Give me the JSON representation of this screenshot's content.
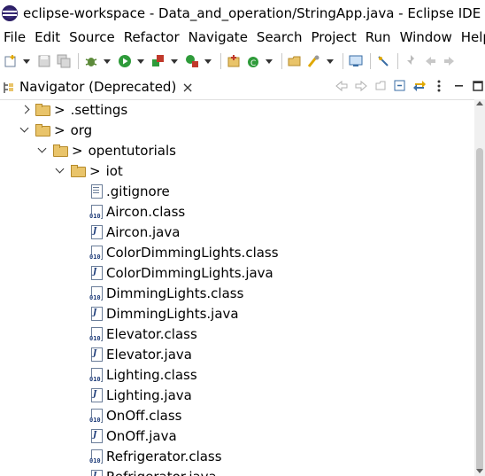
{
  "window": {
    "title": "eclipse-workspace - Data_and_operation/StringApp.java - Eclipse IDE"
  },
  "menubar": {
    "items": [
      {
        "label": "File"
      },
      {
        "label": "Edit"
      },
      {
        "label": "Source"
      },
      {
        "label": "Refactor"
      },
      {
        "label": "Navigate"
      },
      {
        "label": "Search"
      },
      {
        "label": "Project"
      },
      {
        "label": "Run"
      },
      {
        "label": "Window"
      },
      {
        "label": "Help"
      }
    ]
  },
  "toolbar": {
    "icons": [
      "new-icon",
      "save-icon",
      "save-all-icon",
      "debug-icon",
      "run-icon",
      "coverage-icon",
      "external-tools-icon",
      "new-java-project-icon",
      "new-class-icon",
      "open-type-icon",
      "search-icon",
      "console-icon",
      "toggle-mark-icon",
      "pin-icon",
      "back-icon",
      "forward-icon"
    ]
  },
  "view": {
    "title": "Navigator (Deprecated)",
    "close_label": "×",
    "actions": [
      "back-arrow-icon",
      "forward-arrow-icon",
      "go-up-icon",
      "collapse-all-icon",
      "link-with-editor-icon",
      "view-menu-icon",
      "minimize-icon",
      "maximize-icon"
    ]
  },
  "colors": {
    "folder": "#e9c46a",
    "selection": "#cce8ff",
    "scrollbar_thumb": "#c6c6c6"
  },
  "tree": [
    {
      "label": ".settings",
      "kind": "folder",
      "expanded": false,
      "level": 1,
      "decorated": true
    },
    {
      "label": "org",
      "kind": "folder",
      "expanded": true,
      "level": 1,
      "decorated": true
    },
    {
      "label": "opentutorials",
      "kind": "folder",
      "expanded": true,
      "level": 2,
      "decorated": true
    },
    {
      "label": "iot",
      "kind": "folder",
      "expanded": true,
      "level": 3,
      "decorated": true
    },
    {
      "label": ".gitignore",
      "kind": "text",
      "level": 4
    },
    {
      "label": "Aircon.class",
      "kind": "class",
      "level": 4
    },
    {
      "label": "Aircon.java",
      "kind": "java",
      "level": 4
    },
    {
      "label": "ColorDimmingLights.class",
      "kind": "class",
      "level": 4
    },
    {
      "label": "ColorDimmingLights.java",
      "kind": "java",
      "level": 4
    },
    {
      "label": "DimmingLights.class",
      "kind": "class",
      "level": 4
    },
    {
      "label": "DimmingLights.java",
      "kind": "java",
      "level": 4
    },
    {
      "label": "Elevator.class",
      "kind": "class",
      "level": 4
    },
    {
      "label": "Elevator.java",
      "kind": "java",
      "level": 4
    },
    {
      "label": "Lighting.class",
      "kind": "class",
      "level": 4
    },
    {
      "label": "Lighting.java",
      "kind": "java",
      "level": 4
    },
    {
      "label": "OnOff.class",
      "kind": "class",
      "level": 4
    },
    {
      "label": "OnOff.java",
      "kind": "java",
      "level": 4
    },
    {
      "label": "Refrigerator.class",
      "kind": "class",
      "level": 4
    },
    {
      "label": "Refrigerator.java",
      "kind": "java",
      "level": 4
    }
  ]
}
